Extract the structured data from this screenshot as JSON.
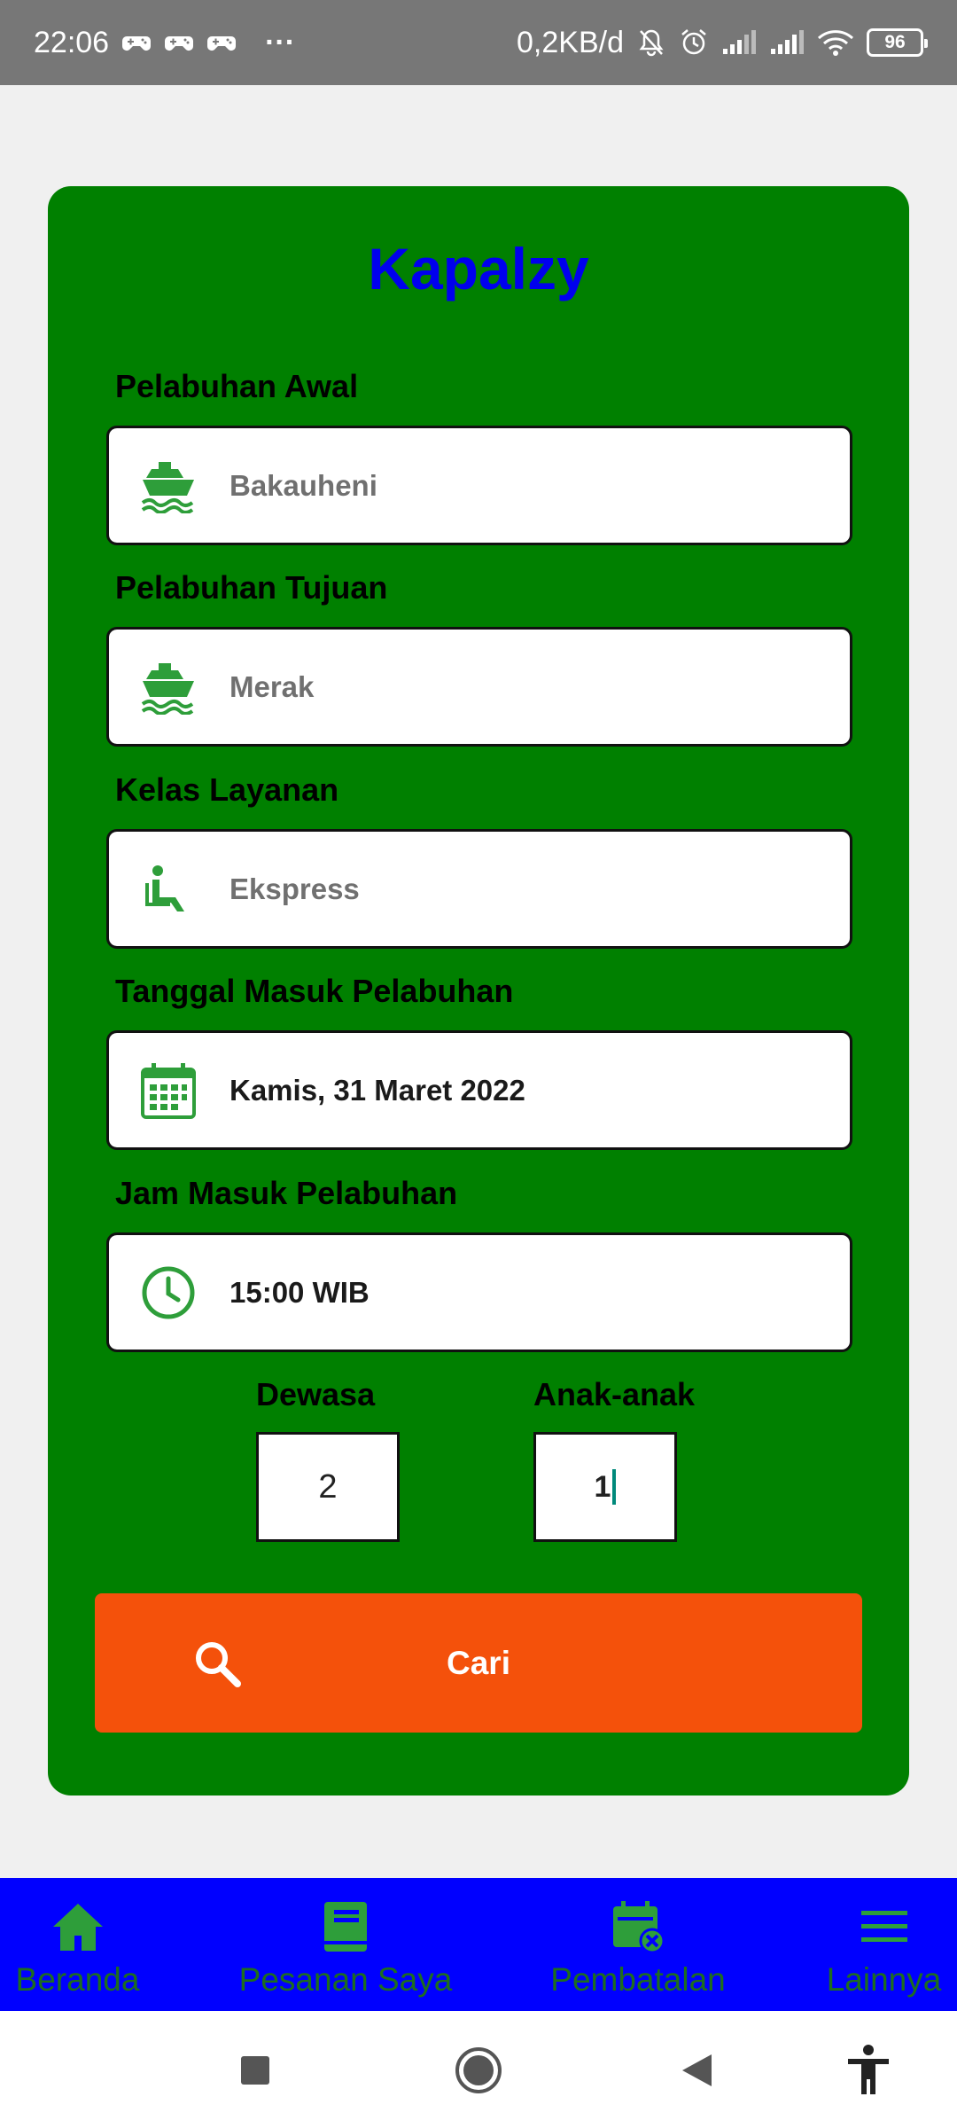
{
  "status_bar": {
    "time": "22:06",
    "more": "···",
    "data_rate": "0,2KB/d",
    "battery": "96"
  },
  "app": {
    "title": "Kapalzy"
  },
  "form": {
    "origin": {
      "label": "Pelabuhan Awal",
      "value": "Bakauheni",
      "icon": "ship-icon"
    },
    "destination": {
      "label": "Pelabuhan Tujuan",
      "value": "Merak",
      "icon": "ship-icon"
    },
    "service_class": {
      "label": "Kelas Layanan",
      "value": "Ekspress",
      "icon": "seat-icon"
    },
    "date": {
      "label": "Tanggal Masuk Pelabuhan",
      "value": "Kamis, 31 Maret 2022",
      "icon": "calendar-icon"
    },
    "time": {
      "label": "Jam Masuk Pelabuhan",
      "value": "15:00 WIB",
      "icon": "clock-icon"
    },
    "adults": {
      "label": "Dewasa",
      "value": "2"
    },
    "children": {
      "label": "Anak-anak",
      "value": "1"
    },
    "search_button": {
      "label": "Cari",
      "icon": "search-icon"
    }
  },
  "bottom_nav": {
    "items": [
      {
        "label": "Beranda",
        "icon": "home-icon"
      },
      {
        "label": "Pesanan Saya",
        "icon": "book-icon"
      },
      {
        "label": "Pembatalan",
        "icon": "calendar-cancel-icon"
      },
      {
        "label": "Lainnya",
        "icon": "menu-icon"
      }
    ]
  },
  "colors": {
    "card": "#008000",
    "title": "#0000ee",
    "accent_icon": "#2e9e3a",
    "search_button": "#f4510b",
    "bottom_nav": "#0000ff",
    "nav_label": "#1e6d1e"
  }
}
